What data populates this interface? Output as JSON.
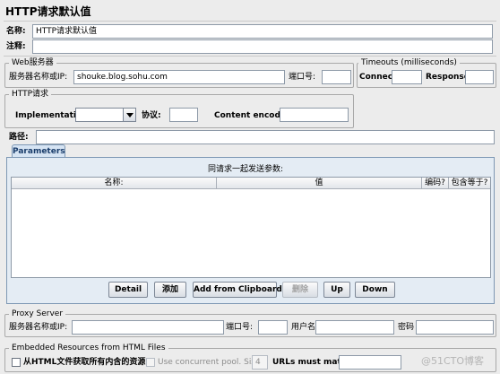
{
  "panel": {
    "title": "HTTP请求默认值",
    "name_label": "名称:",
    "name_value": "HTTP请求默认值",
    "comment_label": "注释:",
    "comment_value": ""
  },
  "web_server": {
    "legend": "Web服务器",
    "server_label": "服务器名称或IP:",
    "server_value": "shouke.blog.sohu.com",
    "port_label": "端口号:",
    "port_value": ""
  },
  "timeouts": {
    "legend": "Timeouts (milliseconds)",
    "connect_label": "Connect:",
    "connect_value": "",
    "response_label": "Response:",
    "response_value": ""
  },
  "http_request": {
    "legend": "HTTP请求",
    "implementation_label": "Implementation:",
    "implementation_value": "",
    "protocol_label": "协议:",
    "protocol_value": "",
    "encoding_label": "Content encoding:",
    "encoding_value": "",
    "path_label": "路径:",
    "path_value": ""
  },
  "parameters": {
    "tab_label": "Parameters",
    "caption": "同请求一起发送参数:",
    "columns": [
      "名称:",
      "值",
      "编码?",
      "包含等于?"
    ],
    "rows": []
  },
  "buttons": {
    "detail": "Detail",
    "add": "添加",
    "add_clipboard": "Add from Clipboard",
    "delete": "删除",
    "up": "Up",
    "down": "Down"
  },
  "proxy": {
    "legend": "Proxy Server",
    "server_label": "服务器名称或IP:",
    "server_value": "",
    "port_label": "端口号:",
    "port_value": "",
    "user_label": "用户名",
    "user_value": "",
    "password_label": "密码",
    "password_value": ""
  },
  "embedded": {
    "legend": "Embedded Resources from HTML Files",
    "retrieve_label": "从HTML文件获取所有内含的资源",
    "concurrent_label": "Use concurrent pool. Size:",
    "pool_size": "4",
    "urls_label": "URLs must match:",
    "urls_value": ""
  },
  "watermark": "@51CTO博客"
}
